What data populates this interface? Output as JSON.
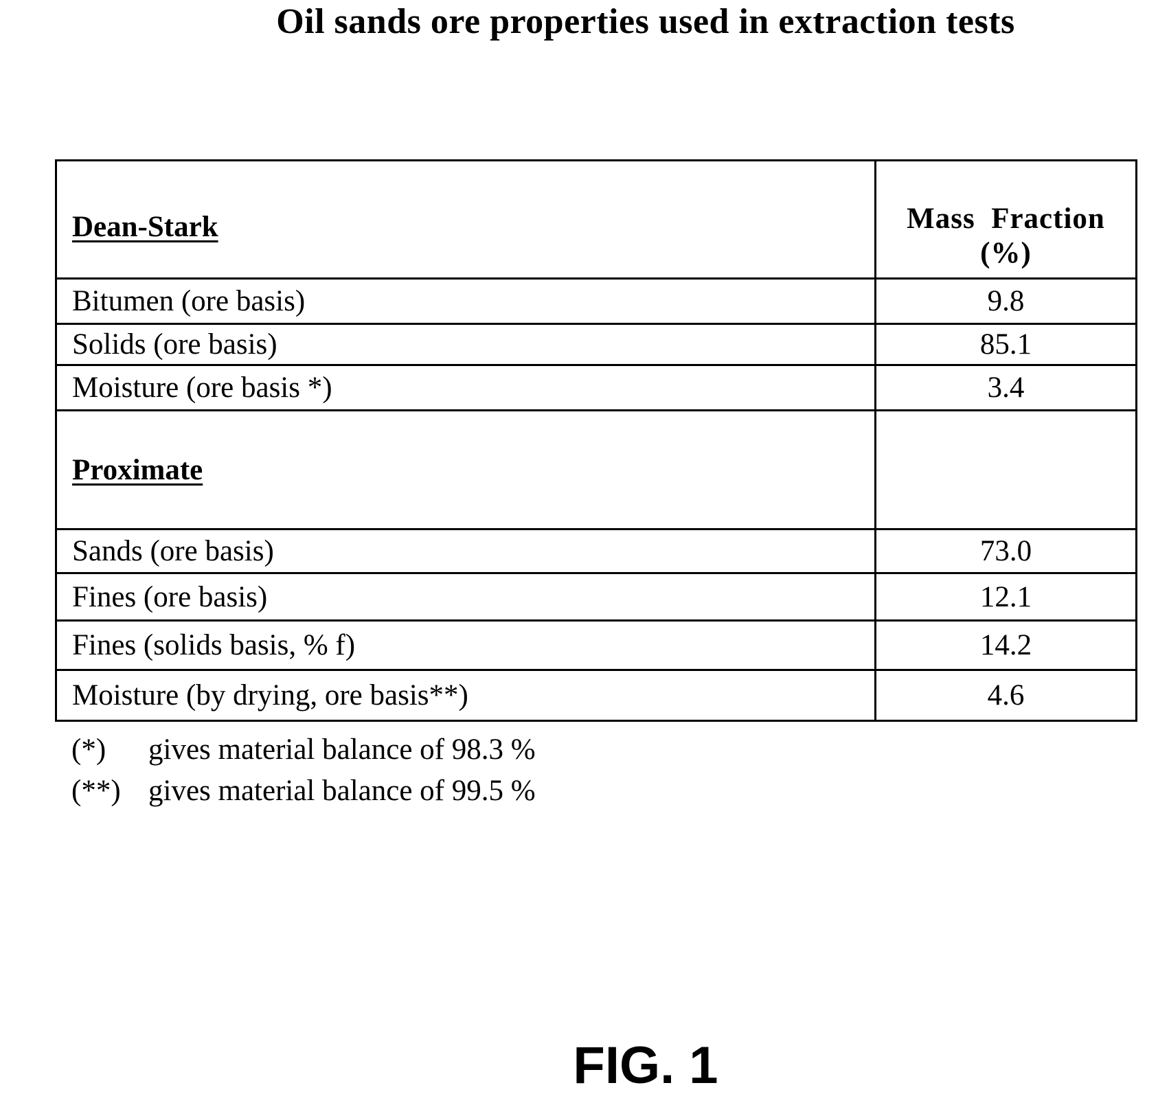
{
  "title": "Oil sands ore properties used in extraction tests",
  "table": {
    "column_header": [
      "Mass  Fraction",
      "(%)"
    ],
    "sections": [
      {
        "heading": "Dean-Stark",
        "rows": [
          {
            "label": "Bitumen (ore basis)",
            "value": "9.8"
          },
          {
            "label": "Solids (ore basis)",
            "value": "85.1"
          },
          {
            "label": "Moisture (ore basis *)",
            "value": "3.4"
          }
        ]
      },
      {
        "heading": "Proximate",
        "rows": [
          {
            "label": "Sands (ore basis)",
            "value": "73.0"
          },
          {
            "label": "Fines (ore basis)",
            "value": "12.1"
          },
          {
            "label": "Fines (solids basis, % f)",
            "value": "14.2"
          },
          {
            "label": "Moisture (by drying, ore basis**)",
            "value": "4.6"
          }
        ]
      }
    ]
  },
  "footnotes": [
    {
      "mark": "(*)",
      "text": "gives material balance of 98.3 %"
    },
    {
      "mark": "(**)",
      "text": "gives material balance of 99.5 %"
    }
  ],
  "figure_label": "FIG. 1"
}
